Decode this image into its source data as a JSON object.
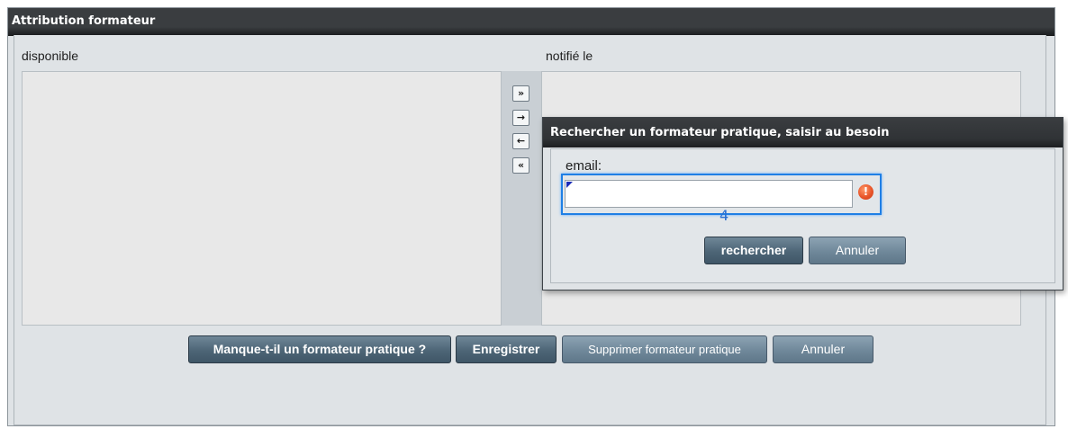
{
  "window": {
    "title": "Attribution formateur"
  },
  "lists": {
    "available_label": "disponible",
    "notified_label": "notifié le"
  },
  "transfer_buttons": [
    {
      "icon": "double-right-arrow-icon",
      "glyph": "»"
    },
    {
      "icon": "right-arrow-icon",
      "glyph": "→"
    },
    {
      "icon": "left-arrow-icon",
      "glyph": "←"
    },
    {
      "icon": "double-left-arrow-icon",
      "glyph": "«"
    }
  ],
  "footer": {
    "missing_trainer_label": "Manque-t-il un formateur pratique ?",
    "save_label": "Enregistrer",
    "delete_label": "Supprimer formateur pratique",
    "cancel_label": "Annuler"
  },
  "dialog": {
    "title": "Rechercher un formateur pratique, saisir au besoin",
    "email_label": "email:",
    "email_value": "",
    "error_glyph": "!",
    "search_label": "rechercher",
    "cancel_label": "Annuler"
  },
  "annotation": {
    "marker": "4"
  },
  "colors": {
    "title_bar": "#3a3d40",
    "panel": "#dfe3e6",
    "button": "#4d6576",
    "focus": "#1f7fe5",
    "error": "#e8552a"
  }
}
